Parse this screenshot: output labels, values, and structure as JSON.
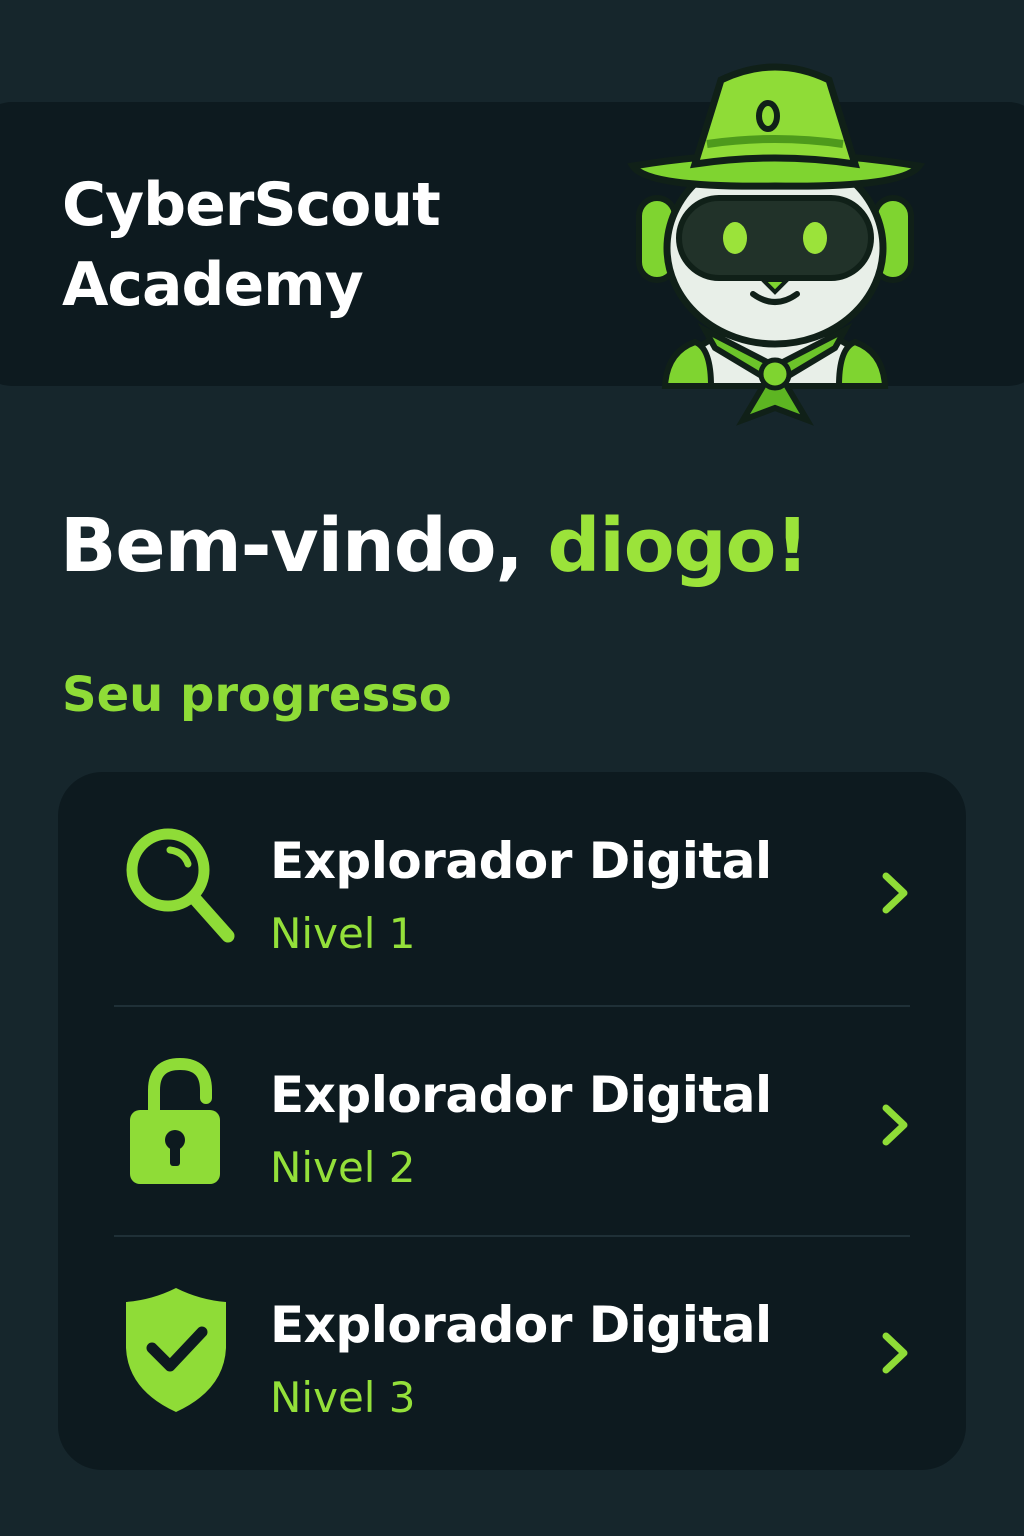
{
  "header": {
    "title_line1": "CyberScout",
    "title_line2": "Academy",
    "mascot_icon": "scout-robot-mascot"
  },
  "welcome": {
    "greeting": "Bem-vindo, ",
    "username": "diogo!"
  },
  "progress": {
    "title": "Seu progresso",
    "levels": [
      {
        "icon": "search-icon",
        "name": "Explorador Digital",
        "level": "Nivel 1"
      },
      {
        "icon": "lock-icon",
        "name": "Explorador Digital",
        "level": "Nivel 2"
      },
      {
        "icon": "shield-check-icon",
        "name": "Explorador Digital",
        "level": "Nivel 3"
      }
    ]
  },
  "colors": {
    "background": "#16262c",
    "card": "#0d1a1f",
    "accent": "#8fdc37",
    "text": "#ffffff"
  }
}
